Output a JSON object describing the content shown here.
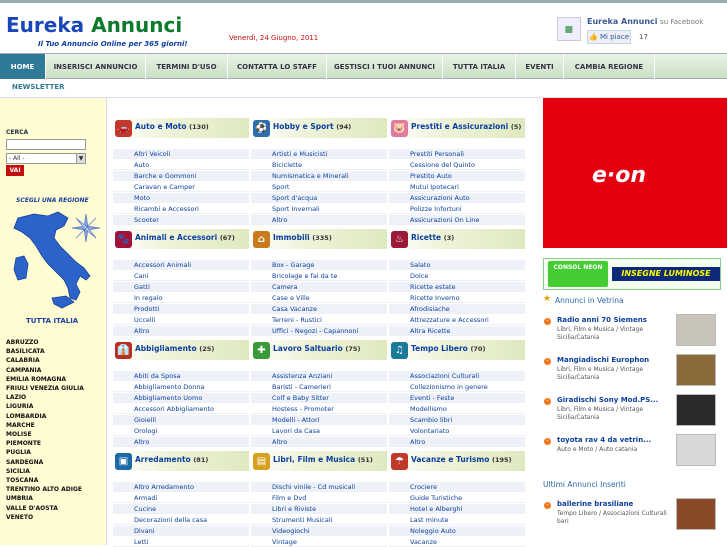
{
  "header": {
    "logo_part1": "Eureka",
    "logo_part2": "Annunci",
    "tagline": "Il Tuo Annuncio Online per 365 giorni!",
    "date": "Venerdì, 24 Giugno, 2011",
    "facebook": {
      "page_name": "Eureka Annunci",
      "suffix": "su Facebook",
      "like_label": "Mi piace",
      "like_count": "17"
    }
  },
  "nav": {
    "items": [
      {
        "label": "HOME"
      },
      {
        "label": "INSERISCI ANNUNCIO"
      },
      {
        "label": "TERMINI D'USO"
      },
      {
        "label": "CONTATTA LO STAFF"
      },
      {
        "label": "GESTISCI I TUOI ANNUNCI"
      },
      {
        "label": "TUTTA ITALIA"
      },
      {
        "label": "EVENTI"
      },
      {
        "label": "CAMBIA REGIONE"
      }
    ],
    "newsletter": "NEWSLETTER"
  },
  "sidebar": {
    "search_label": "CERCA",
    "search_value": "",
    "select_value": "- All -",
    "search_button": "VAI",
    "region_heading": "SCEGLI UNA REGIONE",
    "tutta_italia": "TUTTA ITALIA",
    "regions": [
      "ABRUZZO",
      "BASILICATA",
      "CALABRIA",
      "CAMPANIA",
      "EMILIA ROMAGNA",
      "FRIULI VENEZIA GIULIA",
      "LAZIO",
      "LIGURIA",
      "LOMBARDIA",
      "MARCHE",
      "MOLISE",
      "PIEMONTE",
      "PUGLIA",
      "SARDEGNA",
      "SICILIA",
      "TOSCANA",
      "TRENTINO ALTO ADIGE",
      "UMBRIA",
      "VALLE D'AOSTA",
      "VENETO"
    ]
  },
  "categories": [
    {
      "title": "Auto e Moto",
      "count": "(130)",
      "icon": "car-icon",
      "color": "#c0392b",
      "links": [
        "Altri Veicoli",
        "Auto",
        "Barche e Gommoni",
        "Caravan e Camper",
        "Moto",
        "Ricambi e Accessori",
        "Scooter"
      ]
    },
    {
      "title": "Hobby e Sport",
      "count": "(94)",
      "icon": "soccer-ball-icon",
      "color": "#2b6fb0",
      "links": [
        "Artisti e Musicisti",
        "Biciclette",
        "Numismatica e Minerali",
        "Sport",
        "Sport d'acqua",
        "Sport Invernali",
        "Altro"
      ]
    },
    {
      "title": "Prestiti e Assicurazioni",
      "count": "(5)",
      "icon": "piggy-bank-icon",
      "color": "#e07aa0",
      "links": [
        "Prestiti Personali",
        "Cessione del Quinto",
        "Prestito Auto",
        "Mutui Ipotecari",
        "Assicurazioni Auto",
        "Polizze Infortuni",
        "Assicurazioni On Line"
      ]
    },
    {
      "title": "Animali e Accessori",
      "count": "(67)",
      "icon": "paw-icon",
      "color": "#a3123a",
      "links": [
        "Accessori Animali",
        "Cani",
        "Gatti",
        "In regalo",
        "Prodotti",
        "Uccelli",
        "Altro"
      ]
    },
    {
      "title": "Immobili",
      "count": "(335)",
      "icon": "house-icon",
      "color": "#c97a1a",
      "links": [
        "Box - Garage",
        "Bricolage e fai da te",
        "Camera",
        "Case e Ville",
        "Casa Vacanze",
        "Terreni - Rustici",
        "Uffici - Negozi - Capannoni"
      ]
    },
    {
      "title": "Ricette",
      "count": "(3)",
      "icon": "chef-hat-icon",
      "color": "#9a1a3a",
      "links": [
        "Salato",
        "Dolce",
        "Ricette estate",
        "Ricette Inverno",
        "Afrodisiache",
        "Attrezzature e Accessori",
        "Altra Ricette"
      ]
    },
    {
      "title": "Abbigliamento",
      "count": "(25)",
      "icon": "clothing-icon",
      "color": "#b83020",
      "links": [
        "Abiti da Sposa",
        "Abbigliamento Donna",
        "Abbigliamento Uomo",
        "Accessori Abbigliamento",
        "Gioielli",
        "Orologi",
        "Altro"
      ]
    },
    {
      "title": "Lavoro Saltuario",
      "count": "(75)",
      "icon": "tools-icon",
      "color": "#3a9a3a",
      "links": [
        "Assistenza Anziani",
        "Baristi - Camerieri",
        "Colf e Baby Sitter",
        "Hostess - Promoter",
        "Modelli - Attori",
        "Lavori da Casa",
        "Altro"
      ]
    },
    {
      "title": "Tempo Libero",
      "count": "(70)",
      "icon": "leisure-icon",
      "color": "#1a7a9a",
      "links": [
        "Associazioni Culturali",
        "Collezionismo in genere",
        "Eventi - Feste",
        "Modellismo",
        "Scambio libri",
        "Volontariato",
        "Altro"
      ]
    },
    {
      "title": "Arredamento",
      "count": "(81)",
      "icon": "furniture-icon",
      "color": "#1a6aa8",
      "links": [
        "Altro Arredamento",
        "Armadi",
        "Cucine",
        "Decorazioni della casa",
        "Divani",
        "Letti"
      ]
    },
    {
      "title": "Libri, Film e Musica",
      "count": "(51)",
      "icon": "books-icon",
      "color": "#d8a020",
      "links": [
        "Dischi vinile - Cd musicali",
        "Film e Dvd",
        "Libri e Riviste",
        "Strumenti Musicali",
        "Videogiochi",
        "Vintage"
      ]
    },
    {
      "title": "Vacanze e Turismo",
      "count": "(195)",
      "icon": "beach-icon",
      "color": "#c03a2a",
      "links": [
        "Crociere",
        "Guide Turistiche",
        "Hotel e Alberghi",
        "Last minute",
        "Noleggio Auto",
        "Vacanze"
      ]
    }
  ],
  "right": {
    "ad_eon": "e·on",
    "ad_insegne_logo": "CONSOL NEON",
    "ad_insegne": "INSEGNE LUMINOSE",
    "vetrina_title": "Annunci in Vetrina",
    "vetrina": [
      {
        "title": "Radio anni 70 Siemens",
        "cat": "Libri, Film e Musica / Vintage Sicilia/Catania"
      },
      {
        "title": "Mangiadischi Europhon",
        "cat": "Libri, Film e Musica / Vintage Sicilia/Catania"
      },
      {
        "title": "Giradischi Sony Mod.PS...",
        "cat": "Libri, Film e Musica / Vintage Sicilia/Catania"
      },
      {
        "title": "toyota rav 4 da vetrin...",
        "cat": "Auto e Moto / Auto catania"
      }
    ],
    "ultimi_title": "Ultimi Annunci Inseriti",
    "ultimi": [
      {
        "title": "balleri​ne brasiliane",
        "cat": "Tempo Libero / Associazioni Culturali bari"
      }
    ]
  },
  "colors": {
    "nav_active": "#2f7a96",
    "link": "#0b3f9e",
    "sidebar_bg": "#fffbd2",
    "eon_red": "#e3000f"
  }
}
